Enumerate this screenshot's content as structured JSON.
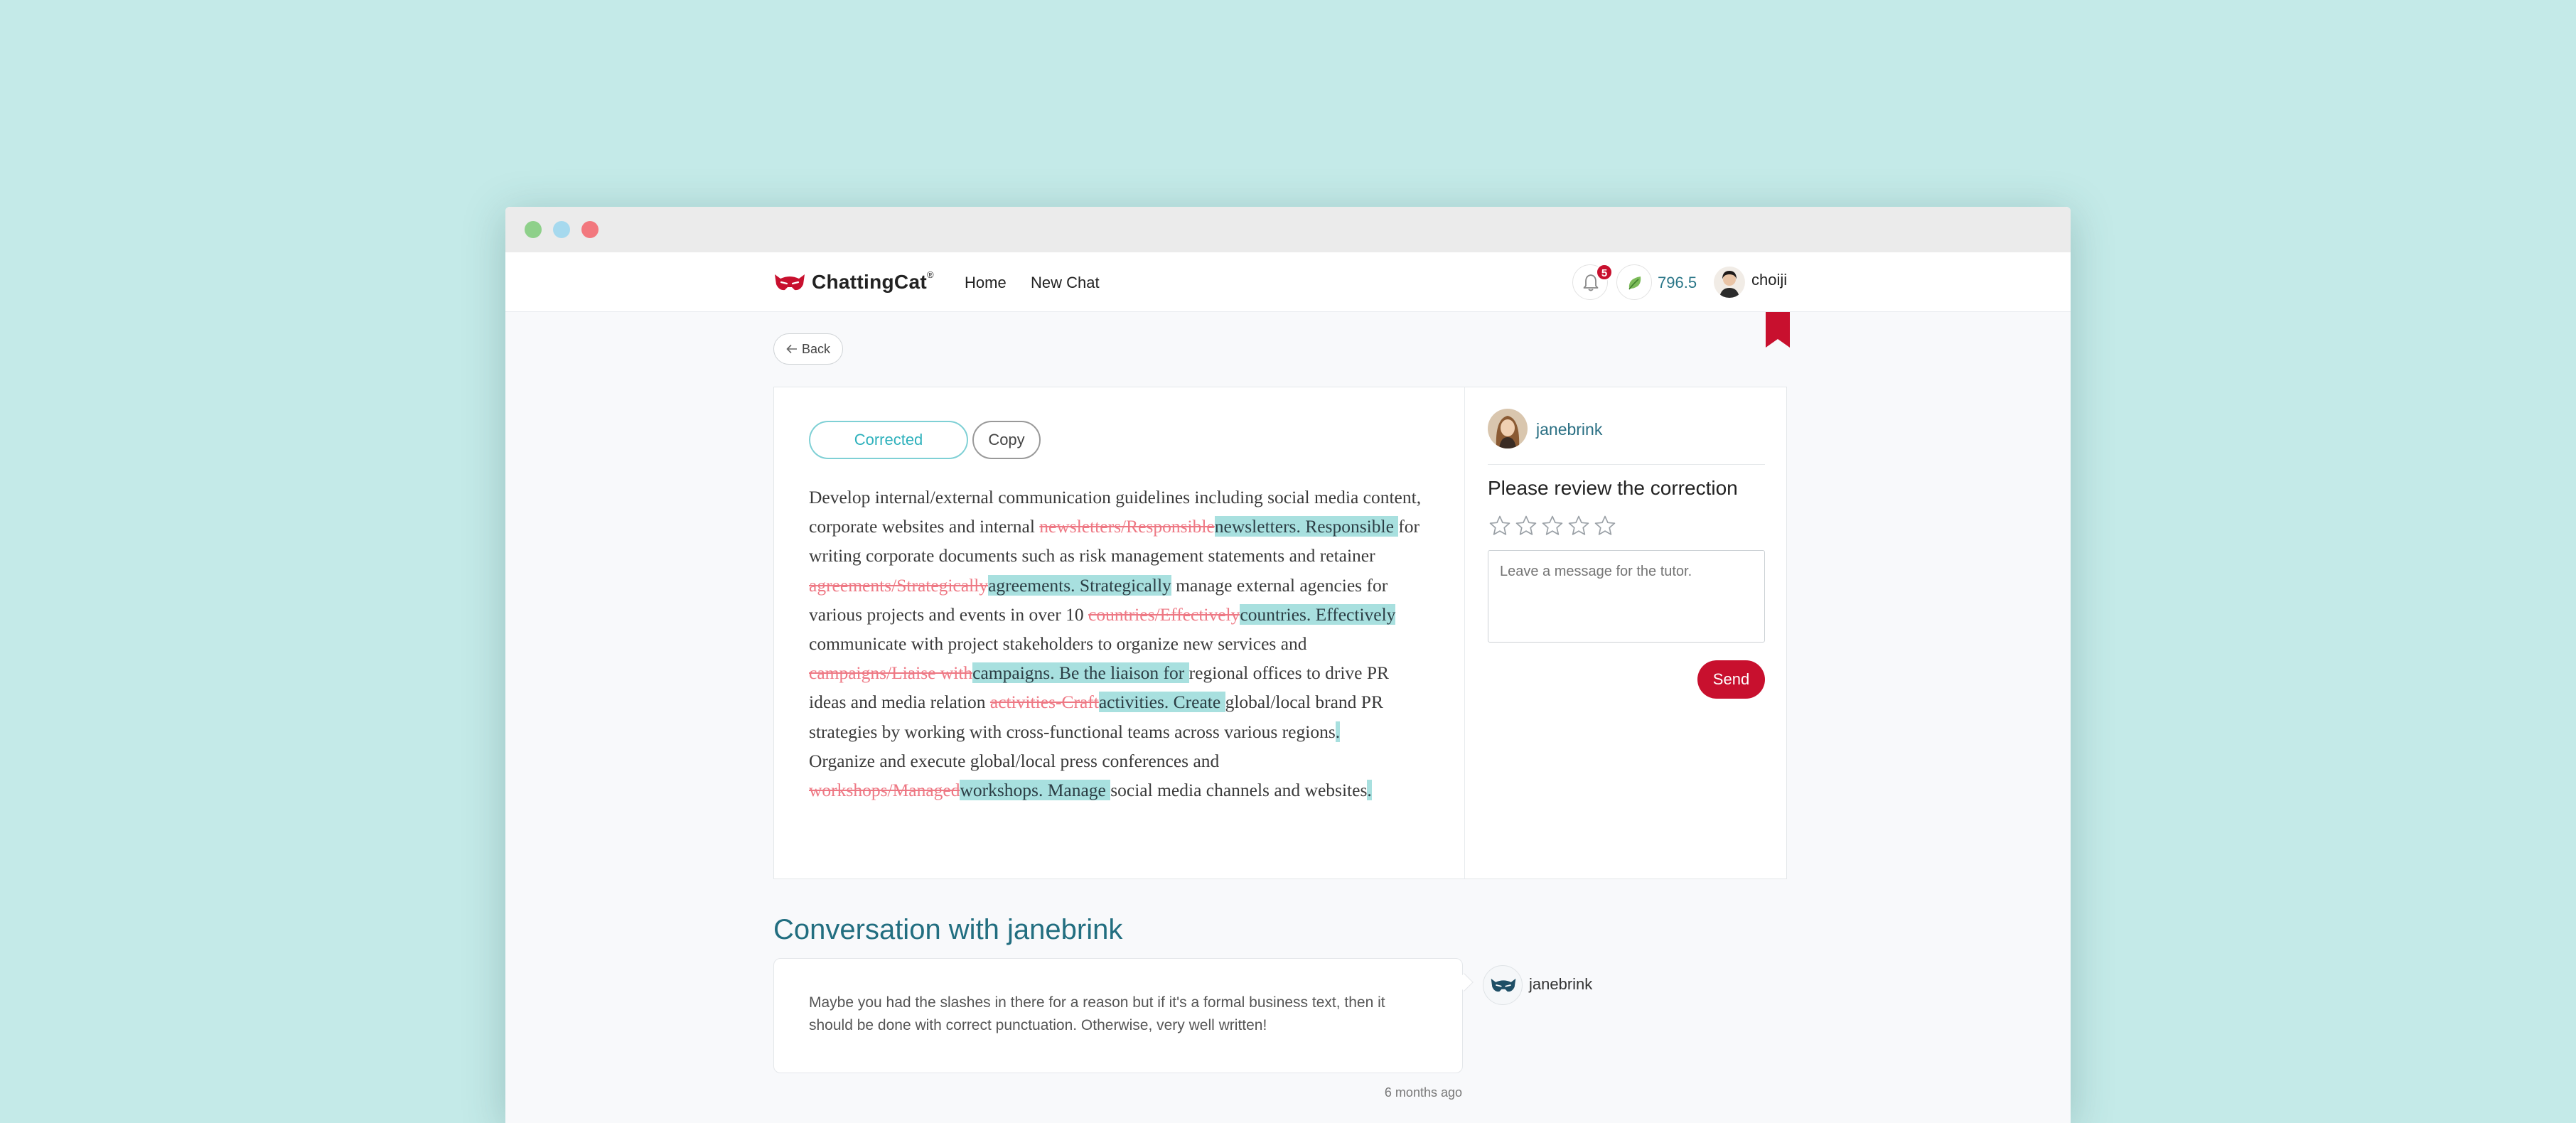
{
  "window": {
    "traffic_lights": [
      "#8ed08a",
      "#a6d9ee",
      "#f2787e"
    ]
  },
  "navbar": {
    "brand": "ChattingCat",
    "brand_mark": "®",
    "brand_color": "#c8102e",
    "links": [
      "Home",
      "New Chat"
    ],
    "notifications_count": "5",
    "points": "796.5",
    "username": "choiji",
    "icons": [
      "bell-icon",
      "leaf-icon",
      "user-avatar"
    ]
  },
  "back_label": "Back",
  "correction": {
    "tabs": {
      "corrected": "Corrected",
      "copy": "Copy"
    },
    "segments": [
      {
        "t": "Develop internal/external communication guidelines including social media content, corporate websites and internal ",
        "k": "n"
      },
      {
        "t": "newsletters/Responsible",
        "k": "d"
      },
      {
        "t": "newsletters. Responsible ",
        "k": "i"
      },
      {
        "t": "for writing corporate documents such as risk management statements and retainer ",
        "k": "n"
      },
      {
        "t": "agreements/Strategically",
        "k": "d"
      },
      {
        "t": "agreements. Strategically",
        "k": "i"
      },
      {
        "t": " manage external agencies for various projects and events in over 10 ",
        "k": "n"
      },
      {
        "t": "countries/Effectively",
        "k": "d"
      },
      {
        "t": "countries. Effectively ",
        "k": "i"
      },
      {
        "t": "communicate with project stakeholders to organize new services and ",
        "k": "n"
      },
      {
        "t": "campaigns/Liaise with",
        "k": "d"
      },
      {
        "t": "campaigns. Be the liaison for ",
        "k": "i"
      },
      {
        "t": "regional offices to drive PR ideas and media relation ",
        "k": "n"
      },
      {
        "t": "activities-Craft",
        "k": "d"
      },
      {
        "t": "activities. Create ",
        "k": "i"
      },
      {
        "t": "global/local brand PR strategies by working with cross-functional teams across various regions",
        "k": "n"
      },
      {
        "t": ".",
        "k": "i"
      },
      {
        "t": "\n",
        "k": "br"
      },
      {
        "t": "Organize and execute global/local press conferences and ",
        "k": "n"
      },
      {
        "t": "workshops/Managed",
        "k": "d"
      },
      {
        "t": "workshops. Manage ",
        "k": "i"
      },
      {
        "t": "social media channels and websites",
        "k": "n"
      },
      {
        "t": ".",
        "k": "i"
      }
    ]
  },
  "review": {
    "tutor_name": "janebrink",
    "title": "Please review the correction",
    "star_count": 5,
    "placeholder": "Leave a message for the tutor.",
    "send_label": "Send"
  },
  "conversation": {
    "title": "Conversation with janebrink",
    "message": "Maybe you had the slashes in there for a reason but if it's a formal business text, then it should be done with correct punctuation. Otherwise, very well written!",
    "author": "janebrink",
    "timestamp": "6 months ago"
  },
  "colors": {
    "accent": "#c8102e",
    "teal_text": "#226e80",
    "insert_highlight": "#a8e0df",
    "deletion": "#ee7884"
  }
}
